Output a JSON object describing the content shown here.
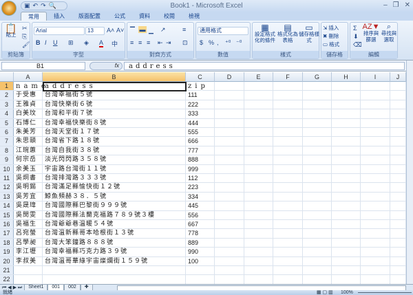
{
  "app": {
    "title": "Book1 - Microsoft Excel",
    "qat": [
      "save-icon",
      "undo-icon",
      "redo-icon",
      "print-preview-icon"
    ]
  },
  "tabs": [
    "常用",
    "插入",
    "版面配置",
    "公式",
    "資料",
    "校閱",
    "檢視"
  ],
  "ribbon": {
    "clipboard": {
      "label": "剪貼簿",
      "paste": "貼上"
    },
    "font": {
      "label": "字型",
      "name": "Arial",
      "size": "13",
      "bold": "B",
      "italic": "I",
      "underline": "U"
    },
    "alignment": {
      "label": "對齊方式"
    },
    "number": {
      "label": "數值",
      "format": "通用格式",
      "currency": "$",
      "percent": "%",
      "comma": ","
    },
    "styles": {
      "label": "樣式",
      "conditional": "設定格式化的條件",
      "table": "格式化為表格",
      "cell": "儲存格樣式"
    },
    "cells": {
      "label": "儲存格",
      "insert": "插入",
      "delete": "刪除",
      "format": "格式"
    },
    "editing": {
      "label": "編輯",
      "sum": "Σ",
      "sort": "排序與篩選",
      "find": "尋找與選取"
    }
  },
  "formula_bar": {
    "name_box": "B1",
    "fx": "fx",
    "value": "address"
  },
  "columns": [
    "A",
    "B",
    "C",
    "D",
    "E",
    "F",
    "G",
    "H",
    "I",
    "J"
  ],
  "selected_column": "B",
  "rows": [
    [
      "name",
      "address",
      "zip"
    ],
    [
      "于受惠",
      "台灣幸福街５號",
      "111"
    ],
    [
      "王雅貞",
      "台灣快樂街６號",
      "222"
    ],
    [
      "白美玟",
      "台灣和平街７號",
      "333"
    ],
    [
      "石博仁",
      "台灣幸福快樂街８號",
      "444"
    ],
    [
      "朱美芳",
      "台灣天堂街１７號",
      "555"
    ],
    [
      "朱思頤",
      "台灣省下路１８號",
      "666"
    ],
    [
      "江琬蕙",
      "台灣自我街３８號",
      "777"
    ],
    [
      "何宗岳",
      "淡光閃閃路３５８號",
      "888"
    ],
    [
      "余美玉",
      "宇宙路台灣街１１號",
      "999"
    ],
    [
      "吳炯書",
      "台灣排灣路３３３號",
      "112"
    ],
    [
      "吳明錫",
      "台灣滿足縣愉快街１２號",
      "223"
    ],
    [
      "吳芳宜",
      "鯨魚頻赫３８．５號",
      "334"
    ],
    [
      "吳晟瑋",
      "台灣國際縣巴黎街９９９號",
      "445"
    ],
    [
      "吳閔雯",
      "台灣國際縣法蘭克福路７８９號３樓",
      "556"
    ],
    [
      "吳福生",
      "台灣爺爺巷溫暖５４號",
      "667"
    ],
    [
      "呂宛螢",
      "台灣溫新縣哥本哈根街１３號",
      "778"
    ],
    [
      "呂學昶",
      "台灣大笨鐘路８８８號",
      "889"
    ],
    [
      "李江壢",
      "台灣幸福縣巧克力路３９號",
      "990"
    ],
    [
      "李叔美",
      "台灣溫哥華綠宇宙燦爛街１５９號",
      "100"
    ],
    [
      "",
      "",
      ""
    ],
    [
      "",
      "",
      ""
    ]
  ],
  "sheets": [
    "Sheet1",
    "001",
    "002"
  ],
  "active_sheet": "001",
  "status": {
    "text": "就緒",
    "zoom": "100%"
  }
}
